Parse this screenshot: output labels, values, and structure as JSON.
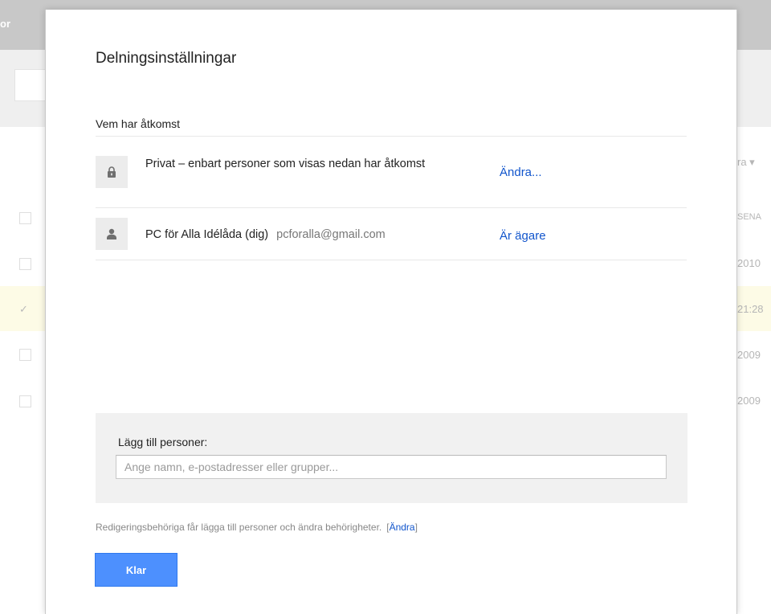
{
  "background": {
    "header_fragment": "or",
    "column_header_right": "SENA",
    "sort_label_fragment": "ra ▾",
    "rows": [
      {
        "right_text": "2010"
      },
      {
        "right_text": "21:28"
      },
      {
        "right_text": "2009"
      },
      {
        "right_text": "2009"
      }
    ]
  },
  "dialog": {
    "title": "Delningsinställningar",
    "access_heading": "Vem har åtkomst",
    "rows": [
      {
        "icon": "lock-icon",
        "text": "Privat – enbart personer som visas nedan har åtkomst",
        "link": "Ändra..."
      },
      {
        "icon": "person-icon",
        "name": "PC för Alla Idélåda (dig)",
        "email": "pcforalla@gmail.com",
        "link": "Är ägare"
      }
    ],
    "add_people": {
      "label": "Lägg till personer:",
      "placeholder": "Ange namn, e-postadresser eller grupper...",
      "value": ""
    },
    "permissions_note": "Redigeringsbehöriga får lägga till personer och ändra behörigheter.",
    "permissions_link": "Ändra",
    "bracket_open": "[",
    "bracket_close": "]",
    "done_label": "Klar"
  },
  "colors": {
    "link": "#1155cc",
    "primary_button": "#4d90fe",
    "overlay_header": "#c8c8c8"
  }
}
